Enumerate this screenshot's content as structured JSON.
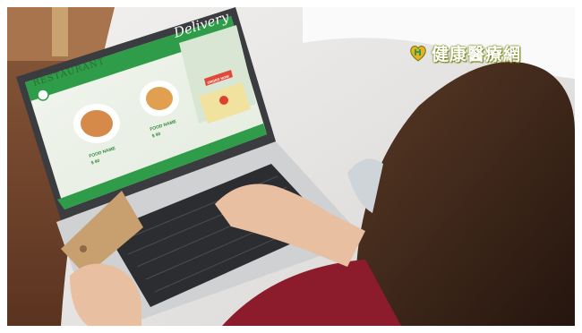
{
  "logo": {
    "text": "健康醫療網",
    "icon": "heart-leaf-logo-icon"
  },
  "screen": {
    "brand": "RESTAURANT",
    "banner_title": "Delivery",
    "items": [
      {
        "name": "FOOD NAME",
        "price": "$ 90"
      },
      {
        "name": "FOOD NAME",
        "price": "$ 90"
      }
    ],
    "order_button": "ORDER NOW"
  },
  "colors": {
    "screen_green": "#2e9c48",
    "panel_light": "#e7efe0",
    "sweater_red": "#8c1c2c",
    "hair_brown": "#3a2418",
    "card_tan": "#c8a070"
  }
}
